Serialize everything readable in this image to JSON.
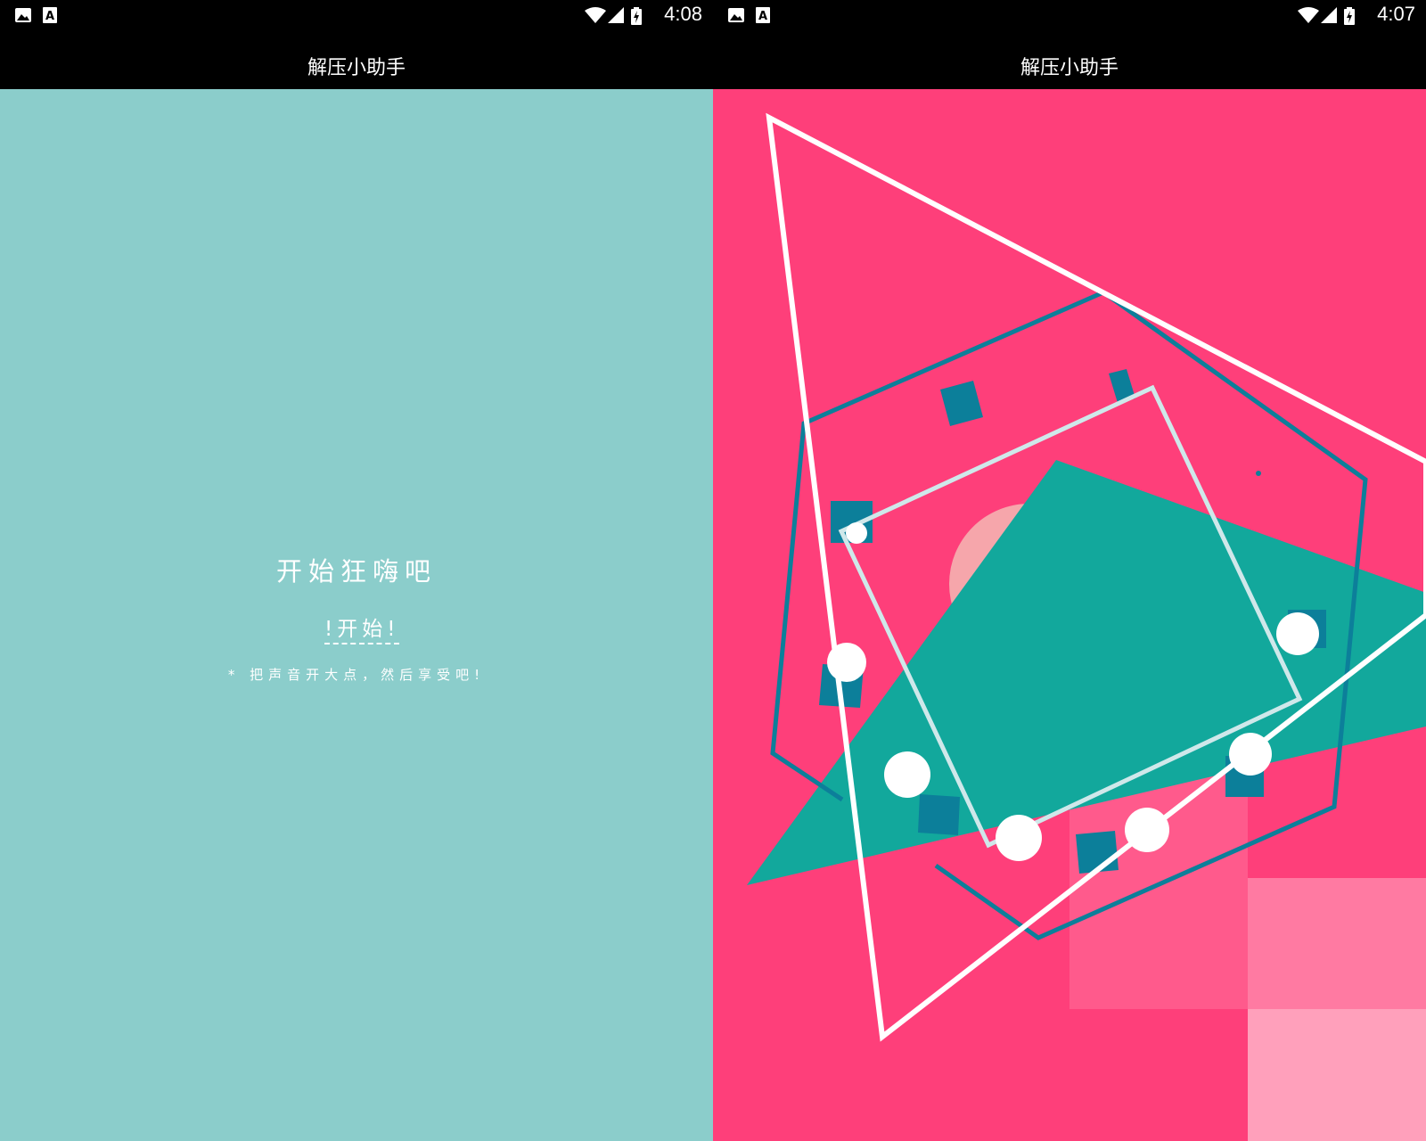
{
  "colors": {
    "left_background": "#8bcdcb",
    "right_background": "#fe3f7a",
    "teal_shape": "#12a89c",
    "dark_teal": "#0c7f9a",
    "white": "#ffffff"
  },
  "screens": [
    {
      "status": {
        "time": "4:08",
        "icons": [
          "image-icon",
          "a-app-icon",
          "wifi-icon",
          "signal-icon",
          "battery-icon"
        ]
      },
      "app_title": "解压小助手",
      "headline": "开始狂嗨吧",
      "start_label": "!开始!",
      "hint": "* 把声音开大点，然后享受吧!"
    },
    {
      "status": {
        "time": "4:07",
        "icons": [
          "image-icon",
          "a-app-icon",
          "wifi-icon",
          "signal-icon",
          "battery-icon"
        ]
      },
      "app_title": "解压小助手"
    }
  ]
}
